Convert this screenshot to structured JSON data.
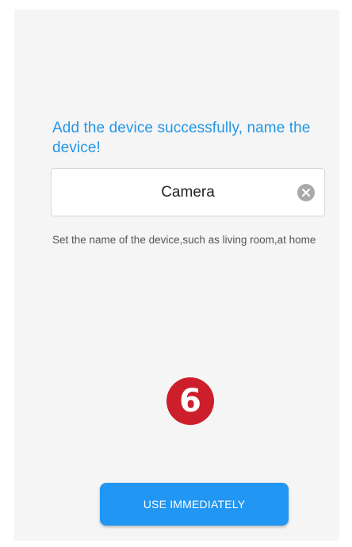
{
  "page": {
    "title": "Add the device successfully, name the device!",
    "name_field": {
      "value": "Camera",
      "clear_icon": "close-icon"
    },
    "hint": "Set the name of the device,such as living room,at home",
    "step_badge": "6",
    "primary_button_label": "USE IMMEDIATELY"
  },
  "colors": {
    "accent": "#2296e6",
    "button": "#2196f3",
    "badge": "#cc1f2b",
    "background": "#f5f5f5"
  }
}
